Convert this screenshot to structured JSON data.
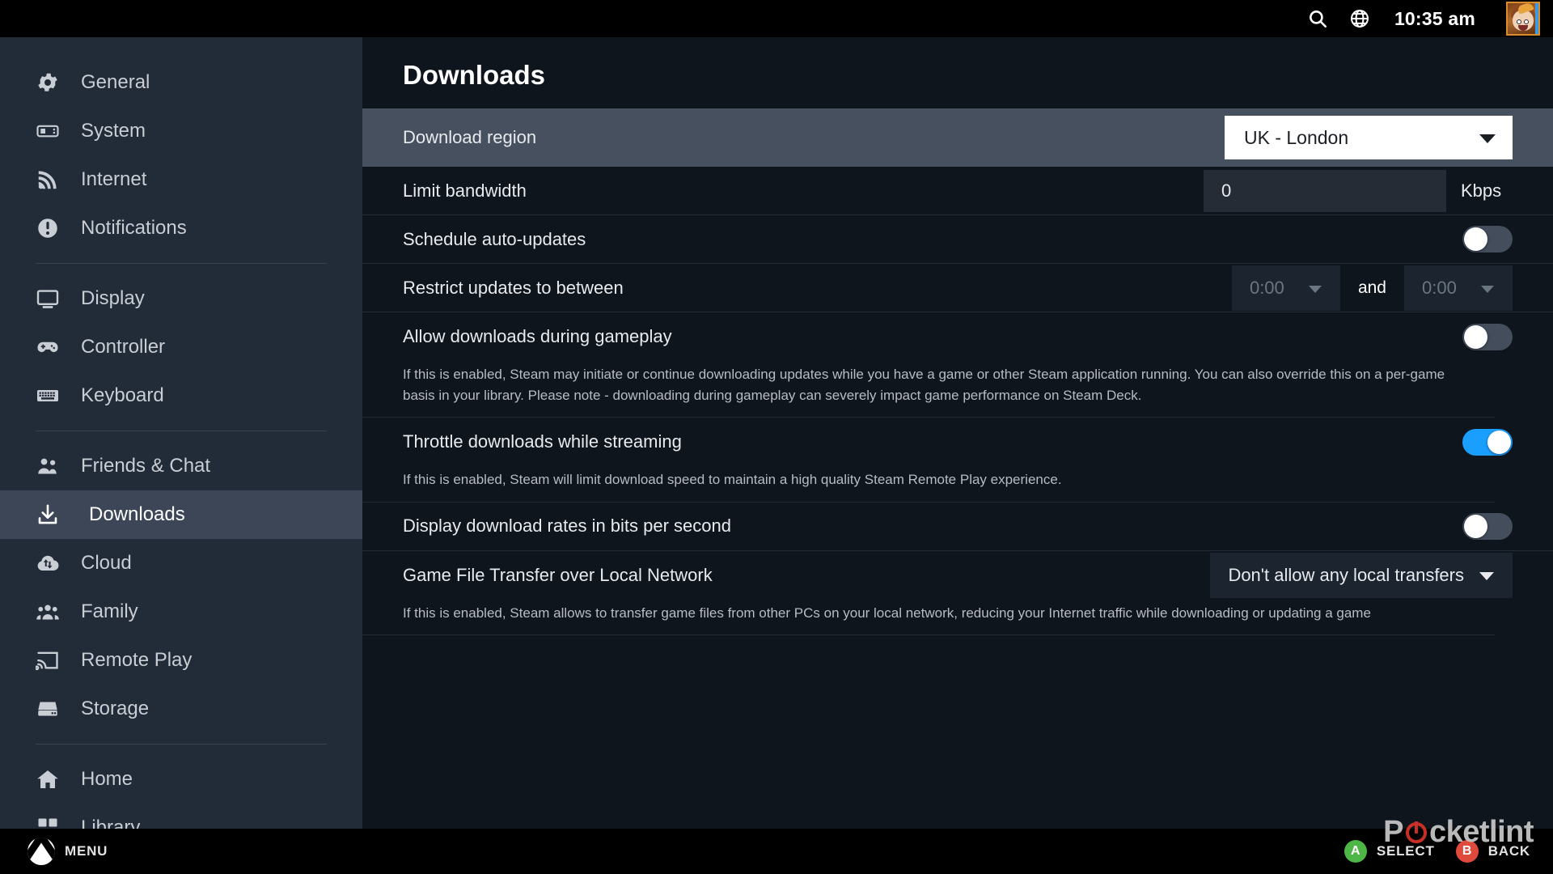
{
  "topbar": {
    "search_icon": "search-icon",
    "globe_icon": "globe-icon",
    "clock": "10:35 am",
    "avatar": "user-avatar"
  },
  "sidebar": {
    "groups": [
      {
        "items": [
          {
            "label": "General",
            "icon": "gear-icon"
          },
          {
            "label": "System",
            "icon": "steamdeck-icon"
          },
          {
            "label": "Internet",
            "icon": "wifi-icon"
          },
          {
            "label": "Notifications",
            "icon": "alert-icon"
          }
        ]
      },
      {
        "items": [
          {
            "label": "Display",
            "icon": "monitor-icon"
          },
          {
            "label": "Controller",
            "icon": "gamepad-icon"
          },
          {
            "label": "Keyboard",
            "icon": "keyboard-icon"
          }
        ]
      },
      {
        "items": [
          {
            "label": "Friends & Chat",
            "icon": "people-icon"
          },
          {
            "label": "Downloads",
            "icon": "download-icon",
            "active": true
          },
          {
            "label": "Cloud",
            "icon": "cloud-sync-icon"
          },
          {
            "label": "Family",
            "icon": "family-icon"
          },
          {
            "label": "Remote Play",
            "icon": "cast-icon"
          },
          {
            "label": "Storage",
            "icon": "storage-icon"
          }
        ]
      },
      {
        "items": [
          {
            "label": "Home",
            "icon": "home-icon"
          },
          {
            "label": "Library",
            "icon": "grid-icon"
          }
        ]
      }
    ]
  },
  "main": {
    "title": "Downloads",
    "download_region": {
      "label": "Download region",
      "value": "UK - London"
    },
    "limit_bandwidth": {
      "label": "Limit bandwidth",
      "value": "0",
      "unit": "Kbps"
    },
    "schedule_auto_updates": {
      "label": "Schedule auto-updates",
      "state": "off"
    },
    "restrict_updates": {
      "label": "Restrict updates to between",
      "from": "0:00",
      "and": "and",
      "to": "0:00"
    },
    "allow_downloads_gameplay": {
      "label": "Allow downloads during gameplay",
      "state": "off",
      "description": "If this is enabled, Steam may initiate or continue downloading updates while you have a game or other Steam application running. You can also override this on a per-game basis in your library. Please note - downloading during gameplay can severely impact game performance on Steam Deck."
    },
    "throttle_streaming": {
      "label": "Throttle downloads while streaming",
      "state": "on",
      "description": "If this is enabled, Steam will limit download speed to maintain a high quality Steam Remote Play experience."
    },
    "bits_per_second": {
      "label": "Display download rates in bits per second",
      "state": "off"
    },
    "game_file_transfer": {
      "label": "Game File Transfer over Local Network",
      "value": "Don't allow any local transfers",
      "description": "If this is enabled, Steam allows to transfer game files from other PCs on your local network, reducing your Internet traffic while downloading or updating a game"
    }
  },
  "bottombar": {
    "menu_label": "MENU",
    "menu_icon": "xbox-logo-icon",
    "select": {
      "button": "A",
      "label": "SELECT"
    },
    "back": {
      "button": "B",
      "label": "BACK"
    }
  },
  "watermark": {
    "prefix": "P",
    "suffix": "cketlint"
  },
  "colors": {
    "accent_blue": "#1a9fff",
    "sidebar_bg": "#222b38",
    "sidebar_active": "#3c4656",
    "main_bg": "#0e151d",
    "row_highlight": "#46505f",
    "select_green": "#4eb547",
    "back_red": "#e04a3c"
  }
}
